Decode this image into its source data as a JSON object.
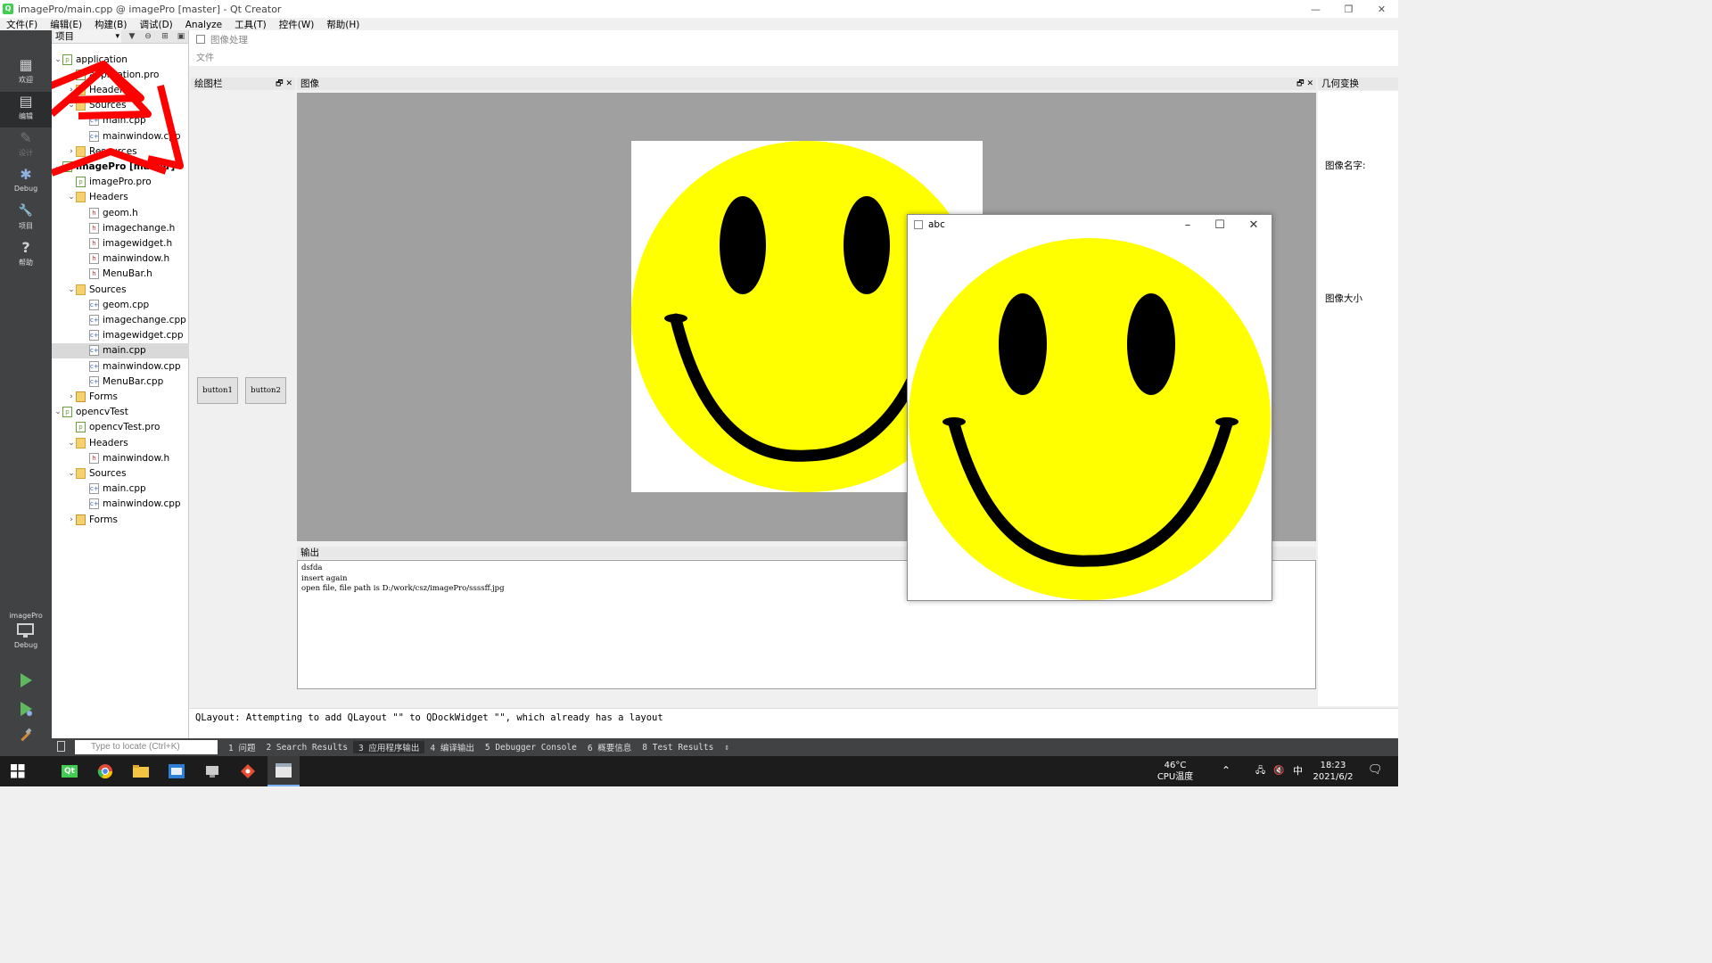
{
  "window": {
    "title": "imagePro/main.cpp @ imagePro [master] - Qt Creator",
    "controls": [
      "—",
      "❐",
      "✕"
    ]
  },
  "menubar": [
    "文件(F)",
    "编辑(E)",
    "构建(B)",
    "调试(D)",
    "Analyze",
    "工具(T)",
    "控件(W)",
    "帮助(H)"
  ],
  "modes": [
    {
      "label": "欢迎",
      "glyph": "▦"
    },
    {
      "label": "编辑",
      "glyph": "▤"
    },
    {
      "label": "设计",
      "glyph": "✎"
    },
    {
      "label": "Debug",
      "glyph": "✱"
    },
    {
      "label": "项目",
      "glyph": "🔧"
    },
    {
      "label": "帮助",
      "glyph": "?"
    }
  ],
  "kit": {
    "project": "imagePro",
    "config": "Debug"
  },
  "project_panel": {
    "selector": "项目",
    "tree": [
      {
        "label": "application",
        "depth": 0,
        "arrow": "⌄",
        "icon": "pro"
      },
      {
        "label": "application.pro",
        "depth": 1,
        "arrow": "",
        "icon": "pro"
      },
      {
        "label": "Headers",
        "depth": 1,
        "arrow": "›",
        "icon": "folder"
      },
      {
        "label": "Sources",
        "depth": 1,
        "arrow": "⌄",
        "icon": "folder"
      },
      {
        "label": "main.cpp",
        "depth": 2,
        "arrow": "",
        "icon": "cpp"
      },
      {
        "label": "mainwindow.cpp",
        "depth": 2,
        "arrow": "",
        "icon": "cpp"
      },
      {
        "label": "Resources",
        "depth": 1,
        "arrow": "›",
        "icon": "folder"
      },
      {
        "label": "imagePro [master]",
        "depth": 0,
        "arrow": "⌄",
        "icon": "pro",
        "bold": true
      },
      {
        "label": "imagePro.pro",
        "depth": 1,
        "arrow": "",
        "icon": "pro"
      },
      {
        "label": "Headers",
        "depth": 1,
        "arrow": "⌄",
        "icon": "folder"
      },
      {
        "label": "geom.h",
        "depth": 2,
        "arrow": "",
        "icon": "hdr"
      },
      {
        "label": "imagechange.h",
        "depth": 2,
        "arrow": "",
        "icon": "hdr"
      },
      {
        "label": "imagewidget.h",
        "depth": 2,
        "arrow": "",
        "icon": "hdr"
      },
      {
        "label": "mainwindow.h",
        "depth": 2,
        "arrow": "",
        "icon": "hdr"
      },
      {
        "label": "MenuBar.h",
        "depth": 2,
        "arrow": "",
        "icon": "hdr"
      },
      {
        "label": "Sources",
        "depth": 1,
        "arrow": "⌄",
        "icon": "folder"
      },
      {
        "label": "geom.cpp",
        "depth": 2,
        "arrow": "",
        "icon": "cpp"
      },
      {
        "label": "imagechange.cpp",
        "depth": 2,
        "arrow": "",
        "icon": "cpp"
      },
      {
        "label": "imagewidget.cpp",
        "depth": 2,
        "arrow": "",
        "icon": "cpp"
      },
      {
        "label": "main.cpp",
        "depth": 2,
        "arrow": "",
        "icon": "cpp",
        "selected": true
      },
      {
        "label": "mainwindow.cpp",
        "depth": 2,
        "arrow": "",
        "icon": "cpp"
      },
      {
        "label": "MenuBar.cpp",
        "depth": 2,
        "arrow": "",
        "icon": "cpp"
      },
      {
        "label": "Forms",
        "depth": 1,
        "arrow": "›",
        "icon": "forms"
      },
      {
        "label": "opencvTest",
        "depth": 0,
        "arrow": "⌄",
        "icon": "pro"
      },
      {
        "label": "opencvTest.pro",
        "depth": 1,
        "arrow": "",
        "icon": "pro"
      },
      {
        "label": "Headers",
        "depth": 1,
        "arrow": "⌄",
        "icon": "folder"
      },
      {
        "label": "mainwindow.h",
        "depth": 2,
        "arrow": "",
        "icon": "hdr"
      },
      {
        "label": "Sources",
        "depth": 1,
        "arrow": "⌄",
        "icon": "folder"
      },
      {
        "label": "main.cpp",
        "depth": 2,
        "arrow": "",
        "icon": "cpp"
      },
      {
        "label": "mainwindow.cpp",
        "depth": 2,
        "arrow": "",
        "icon": "cpp"
      },
      {
        "label": "Forms",
        "depth": 1,
        "arrow": "›",
        "icon": "forms"
      }
    ]
  },
  "app": {
    "title": "图像处理",
    "menu": "文件",
    "draw_dock": {
      "title": "绘图栏",
      "buttons": [
        "button1",
        "button2"
      ]
    },
    "image_dock": {
      "title": "图像"
    },
    "output_dock": {
      "title": "输出",
      "lines": [
        "dsfda",
        "insert again",
        "open file, file path is D:/work/csz/imagePro/ssssff.jpg"
      ]
    },
    "geo_dock": {
      "title": "几何变换",
      "name_label": "图像名字:",
      "size_label": "图像大小"
    },
    "floating_window": {
      "title": "abc"
    },
    "colors": {
      "face": "#ffff00",
      "feature": "#000000",
      "backdrop": "#a0a0a0"
    }
  },
  "app_output_message": "QLayout: Attempting to add QLayout \"\" to QDockWidget \"\", which already has a layout",
  "output_panes": {
    "locate_placeholder": "Type to locate (Ctrl+K)",
    "tabs": [
      "1 问题",
      "2 Search Results",
      "3 应用程序输出",
      "4 编译输出",
      "5 Debugger Console",
      "6 概要信息",
      "8 Test Results"
    ],
    "active_tab": 2
  },
  "taskbar": {
    "temperature": "46°C",
    "temp_label": "CPU温度",
    "ime": "中",
    "time": "18:23",
    "date": "2021/6/2"
  }
}
